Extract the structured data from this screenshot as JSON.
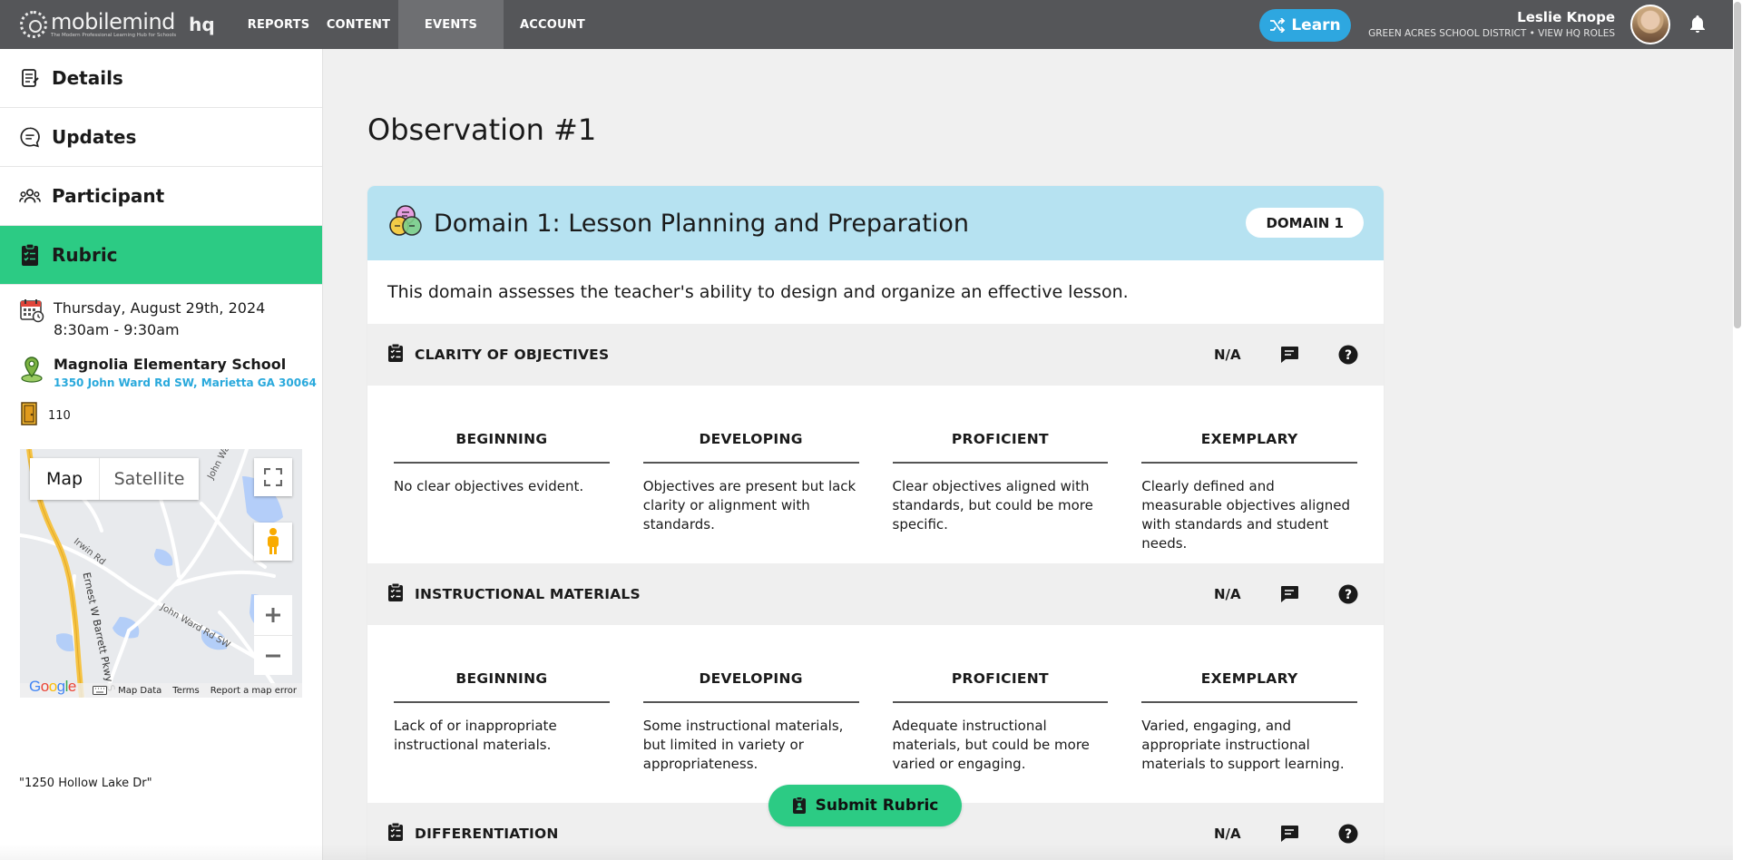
{
  "app": {
    "logo_name": "mobilemind",
    "logo_tagline": "The Modern Professional Learning Hub for Schools",
    "logo_hq": "hq"
  },
  "nav": {
    "items": [
      {
        "label": "REPORTS",
        "active": false
      },
      {
        "label": "CONTENT",
        "active": false
      },
      {
        "label": "EVENTS",
        "active": true
      },
      {
        "label": "ACCOUNT",
        "active": false
      }
    ],
    "learn_label": "Learn"
  },
  "user": {
    "name": "Leslie Knope",
    "subtitle": "GREEN ACRES SCHOOL DISTRICT • VIEW HQ ROLES"
  },
  "sidebar": {
    "items": [
      {
        "label": "Details",
        "icon": "details-icon",
        "active": false
      },
      {
        "label": "Updates",
        "icon": "chat-bubble-icon",
        "active": false
      },
      {
        "label": "Participant",
        "icon": "people-icon",
        "active": false
      },
      {
        "label": "Rubric",
        "icon": "clipboard-icon",
        "active": true
      }
    ],
    "date": "Thursday, August 29th, 2024",
    "time": "8:30am - 9:30am",
    "location_name": "Magnolia Elementary School",
    "location_address": "1350 John Ward Rd SW, Marietta GA 30064",
    "room": "110",
    "note": "\"1250 Hollow Lake Dr\""
  },
  "map": {
    "map_label": "Map",
    "satellite_label": "Satellite",
    "google_label": "Google",
    "footer": {
      "data": "Map Data",
      "terms": "Terms",
      "report": "Report a map error"
    },
    "streets": {
      "john_ward_1": "John Ward Rd",
      "john_ward_2": "John Ward Rd SW",
      "irwin": "Irwin Rd",
      "barrett": "Ernest W Barrett Pkwy S"
    }
  },
  "main": {
    "title": "Observation #1",
    "domain": {
      "title": "Domain 1: Lesson Planning and Preparation",
      "badge": "DOMAIN 1",
      "description": "This domain assesses the teacher's ability to design and organize an effective lesson."
    },
    "criteria": [
      {
        "title": "CLARITY OF OBJECTIVES",
        "score": "N/A",
        "levels": [
          {
            "name": "BEGINNING",
            "desc": "No clear objectives evident."
          },
          {
            "name": "DEVELOPING",
            "desc": "Objectives are present but lack clarity or alignment with standards."
          },
          {
            "name": "PROFICIENT",
            "desc": "Clear objectives aligned with standards, but could be more specific."
          },
          {
            "name": "EXEMPLARY",
            "desc": "Clearly defined and measurable objectives aligned with standards and student needs."
          }
        ]
      },
      {
        "title": "INSTRUCTIONAL MATERIALS",
        "score": "N/A",
        "levels": [
          {
            "name": "BEGINNING",
            "desc": "Lack of or inappropriate instructional materials."
          },
          {
            "name": "DEVELOPING",
            "desc": "Some instructional materials, but limited in variety or appropriateness."
          },
          {
            "name": "PROFICIENT",
            "desc": "Adequate instructional materials, but could be more varied or engaging."
          },
          {
            "name": "EXEMPLARY",
            "desc": "Varied, engaging, and appropriate instructional materials to support learning."
          }
        ]
      },
      {
        "title": "DIFFERENTIATION",
        "score": "N/A"
      }
    ],
    "submit_label": "Submit Rubric"
  },
  "colors": {
    "topbar": "#555659",
    "accent_green": "#2ccb84",
    "learn_blue": "#2ea7e0",
    "domain_header": "#b6e2f1",
    "address_blue": "#29a9dc"
  }
}
